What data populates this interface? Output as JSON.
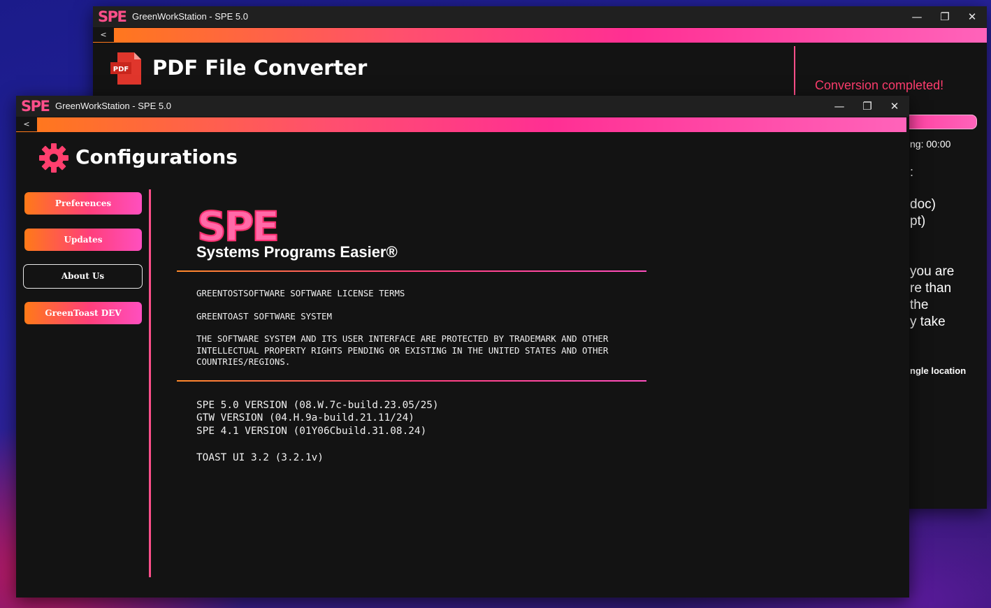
{
  "colors": {
    "accent_pink": "#ff4f8a",
    "accent_orange": "#ff7a18",
    "status_red": "#ff3d6e",
    "window_bg": "#131313"
  },
  "back_window": {
    "logo": "SPE",
    "title": "GreenWorkStation - SPE 5.0",
    "back_label": "<",
    "icon": "pdf-file-icon",
    "icon_text": "PDF",
    "page_title": "PDF File Converter",
    "status": "Conversion completed!",
    "time_text": "ng: 00:00",
    "colon": ":",
    "fragments": [
      "doc)",
      "pt)",
      "you are",
      "re than",
      "the",
      "y take"
    ],
    "location_text": "ngle location"
  },
  "front_window": {
    "logo": "SPE",
    "title": "GreenWorkStation - SPE 5.0",
    "back_label": "<",
    "header": {
      "icon": "gear-icon",
      "title": "Configurations"
    },
    "sidebar": [
      {
        "label": "Preferences",
        "active": false
      },
      {
        "label": "Updates",
        "active": false
      },
      {
        "label": "About Us",
        "active": true
      },
      {
        "label": "GreenToast DEV",
        "active": false
      }
    ],
    "about": {
      "logo": "SPE",
      "tagline": "Systems Programs Easier®",
      "license": [
        "GREENTOSTSOFTWARE SOFTWARE LICENSE TERMS",
        "GREENTOAST SOFTWARE SYSTEM",
        "THE SOFTWARE SYSTEM AND ITS USER INTERFACE ARE PROTECTED BY TRADEMARK AND OTHER",
        "INTELLECTUAL PROPERTY RIGHTS PENDING OR EXISTING IN THE UNITED STATES AND OTHER",
        "COUNTRIES/REGIONS."
      ],
      "versions": [
        "SPE 5.0 VERSION (08.W.7c-build.23.05/25)",
        "GTW VERSION (04.H.9a-build.21.11/24)",
        "SPE 4.1 VERSION (01Y06Cbuild.31.08.24)",
        "TOAST UI 3.2 (3.2.1v)"
      ]
    }
  }
}
